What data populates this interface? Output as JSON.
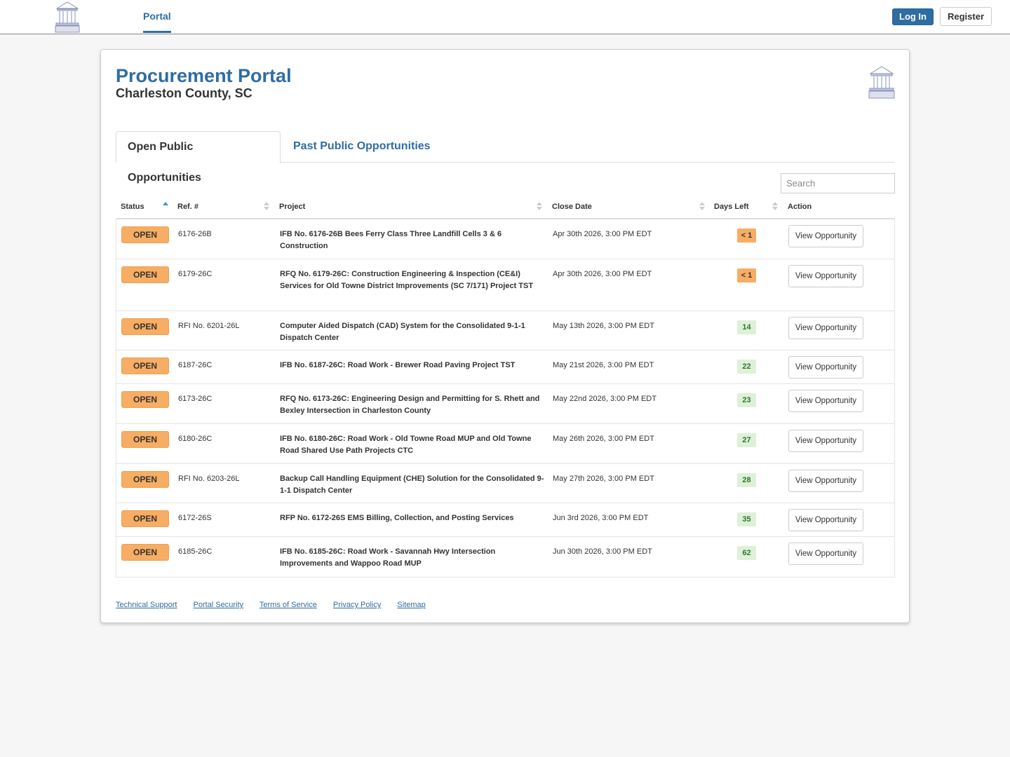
{
  "nav": {
    "portal_label": "Portal",
    "login_label": "Log In",
    "register_label": "Register"
  },
  "header": {
    "title": "Procurement Portal",
    "subtitle": "Charleston County, SC"
  },
  "tabs": [
    {
      "label": "Open Public Opportunities",
      "active": true
    },
    {
      "label": "Past Public Opportunities",
      "active": false
    }
  ],
  "search": {
    "placeholder": "Search"
  },
  "table": {
    "columns": [
      "Status",
      "Ref. #",
      "Project",
      "Close Date",
      "Days Left",
      "Action"
    ],
    "rows": [
      {
        "status": "OPEN",
        "ref": "6176-26B",
        "project": "IFB No. 6176-26B Bees Ferry Class Three Landfill Cells 3 & 6 Construction",
        "close": "Apr 30th 2026, 3:00 PM EDT",
        "days": "< 1",
        "urgent": true,
        "action": "View Opportunity"
      },
      {
        "status": "OPEN",
        "ref": "6179-26C",
        "project": "RFQ No. 6179-26C: Construction Engineering & Inspection (CE&I) Services for Old Towne District Improvements (SC 7/171) Project TST",
        "close": "Apr 30th 2026, 3:00 PM EDT",
        "days": "< 1",
        "urgent": true,
        "action": "View Opportunity"
      },
      {
        "status": "OPEN",
        "ref": "RFI No. 6201-26L",
        "project": "Computer Aided Dispatch (CAD) System for the Consolidated 9-1-1 Dispatch Center",
        "close": "May 13th 2026, 3:00 PM EDT",
        "days": "14",
        "urgent": false,
        "action": "View Opportunity"
      },
      {
        "status": "OPEN",
        "ref": "6187-26C",
        "project": "IFB No. 6187-26C: Road Work - Brewer Road Paving Project TST",
        "close": "May 21st 2026, 3:00 PM EDT",
        "days": "22",
        "urgent": false,
        "action": "View Opportunity"
      },
      {
        "status": "OPEN",
        "ref": "6173-26C",
        "project": "RFQ No. 6173-26C: Engineering Design and Permitting for S. Rhett and Bexley Intersection in Charleston County",
        "close": "May 22nd 2026, 3:00 PM EDT",
        "days": "23",
        "urgent": false,
        "action": "View Opportunity"
      },
      {
        "status": "OPEN",
        "ref": "6180-26C",
        "project": "IFB No. 6180-26C: Road Work - Old Towne Road MUP and Old Towne Road Shared Use Path Projects CTC",
        "close": "May 26th 2026, 3:00 PM EDT",
        "days": "27",
        "urgent": false,
        "action": "View Opportunity"
      },
      {
        "status": "OPEN",
        "ref": "RFI No. 6203-26L",
        "project": "Backup Call Handling Equipment (CHE) Solution for the Consolidated 9-1-1 Dispatch Center",
        "close": "May 27th 2026, 3:00 PM EDT",
        "days": "28",
        "urgent": false,
        "action": "View Opportunity"
      },
      {
        "status": "OPEN",
        "ref": "6172-26S",
        "project": "RFP No. 6172-26S EMS Billing, Collection, and Posting Services",
        "close": "Jun 3rd 2026, 3:00 PM EDT",
        "days": "35",
        "urgent": false,
        "action": "View Opportunity"
      },
      {
        "status": "OPEN",
        "ref": "6185-26C",
        "project": "IFB No. 6185-26C: Road Work - Savannah Hwy Intersection Improvements and Wappoo Road MUP",
        "close": "Jun 30th 2026, 3:00 PM EDT",
        "days": "62",
        "urgent": false,
        "action": "View Opportunity"
      }
    ]
  },
  "footer": {
    "links": [
      "Technical Support",
      "Portal Security",
      "Terms of Service",
      "Privacy Policy",
      "Sitemap"
    ]
  },
  "colors": {
    "brand": "#2e6da4",
    "open_badge": "#f7ad63",
    "days_ok_bg": "#dff0d8"
  }
}
